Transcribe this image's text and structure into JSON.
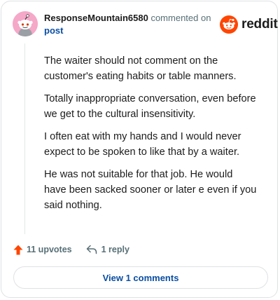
{
  "comment": {
    "username": "ResponseMountain6580",
    "action_text": "commented on",
    "target_link": "post",
    "paragraphs": [
      "The waiter should not comment on the customer's eating habits or table manners.",
      "Totally inappropriate conversation, even before we get to the cultural insensitivity.",
      "I often eat with my hands and I would never expect to be spoken to like that by a waiter.",
      "He was not suitable for that job. He would have been sacked sooner or later e even if you said nothing."
    ]
  },
  "brand": {
    "name": "reddit",
    "color": "#ff4500"
  },
  "actions": {
    "upvotes_label": "11 upvotes",
    "reply_label": "1 reply"
  },
  "view_button": {
    "label": "View 1 comments"
  },
  "icons": {
    "avatar": "snoo-avatar-icon",
    "logo": "reddit-logo-icon",
    "upvote": "upvote-arrow-icon",
    "reply": "reply-arrow-icon"
  },
  "colors": {
    "upvote": "#ff4500",
    "link": "#0a4ea3",
    "muted": "#576f76",
    "avatar_bg": "#f5a8c8"
  }
}
